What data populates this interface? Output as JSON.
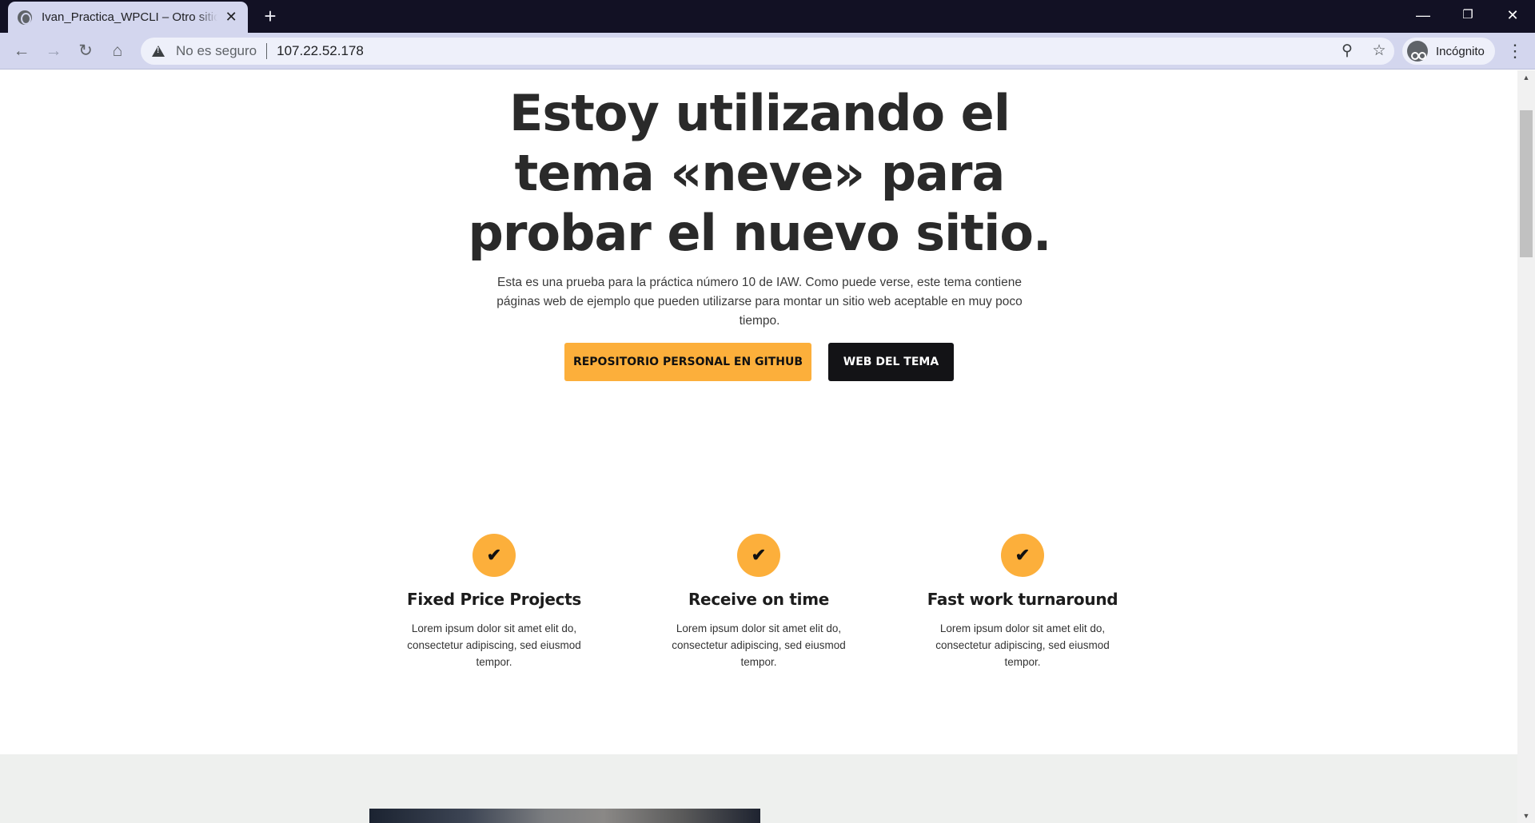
{
  "browser": {
    "tab_title": "Ivan_Practica_WPCLI – Otro sitio",
    "tab_close": "✕",
    "new_tab": "+",
    "security_label": "No es seguro",
    "url": "107.22.52.178",
    "incognito_label": "Incógnito",
    "icons": [
      "globe-icon",
      "back-icon",
      "forward-icon",
      "reload-icon",
      "home-icon",
      "warning-icon",
      "zoom-icon",
      "star-icon",
      "incognito-icon",
      "menu-icon",
      "minimize-icon",
      "restore-icon",
      "close-icon"
    ]
  },
  "hero": {
    "title": "Estoy utilizando el tema «neve» para probar el nuevo sitio.",
    "subtitle": "Esta es una prueba para la práctica número 10 de IAW. Como puede verse, este tema contiene páginas web de ejemplo que pueden utilizarse para montar un sitio web aceptable en muy poco tiempo.",
    "primary_button": "REPOSITORIO PERSONAL EN GITHUB",
    "secondary_button": "WEB DEL TEMA"
  },
  "features": [
    {
      "title": "Fixed Price Projects",
      "text": "Lorem ipsum dolor sit amet elit do, consectetur adipiscing, sed eiusmod tempor."
    },
    {
      "title": "Receive on time",
      "text": "Lorem ipsum dolor sit amet elit do, consectetur adipiscing, sed eiusmod tempor."
    },
    {
      "title": "Fast work turnaround",
      "text": "Lorem ipsum dolor sit amet elit do, consectetur adipiscing, sed eiusmod tempor."
    }
  ],
  "colors": {
    "accent": "#fcaf3b",
    "dark_button": "#131316",
    "titlebar": "#121124",
    "toolbar": "#d3d6ee"
  }
}
